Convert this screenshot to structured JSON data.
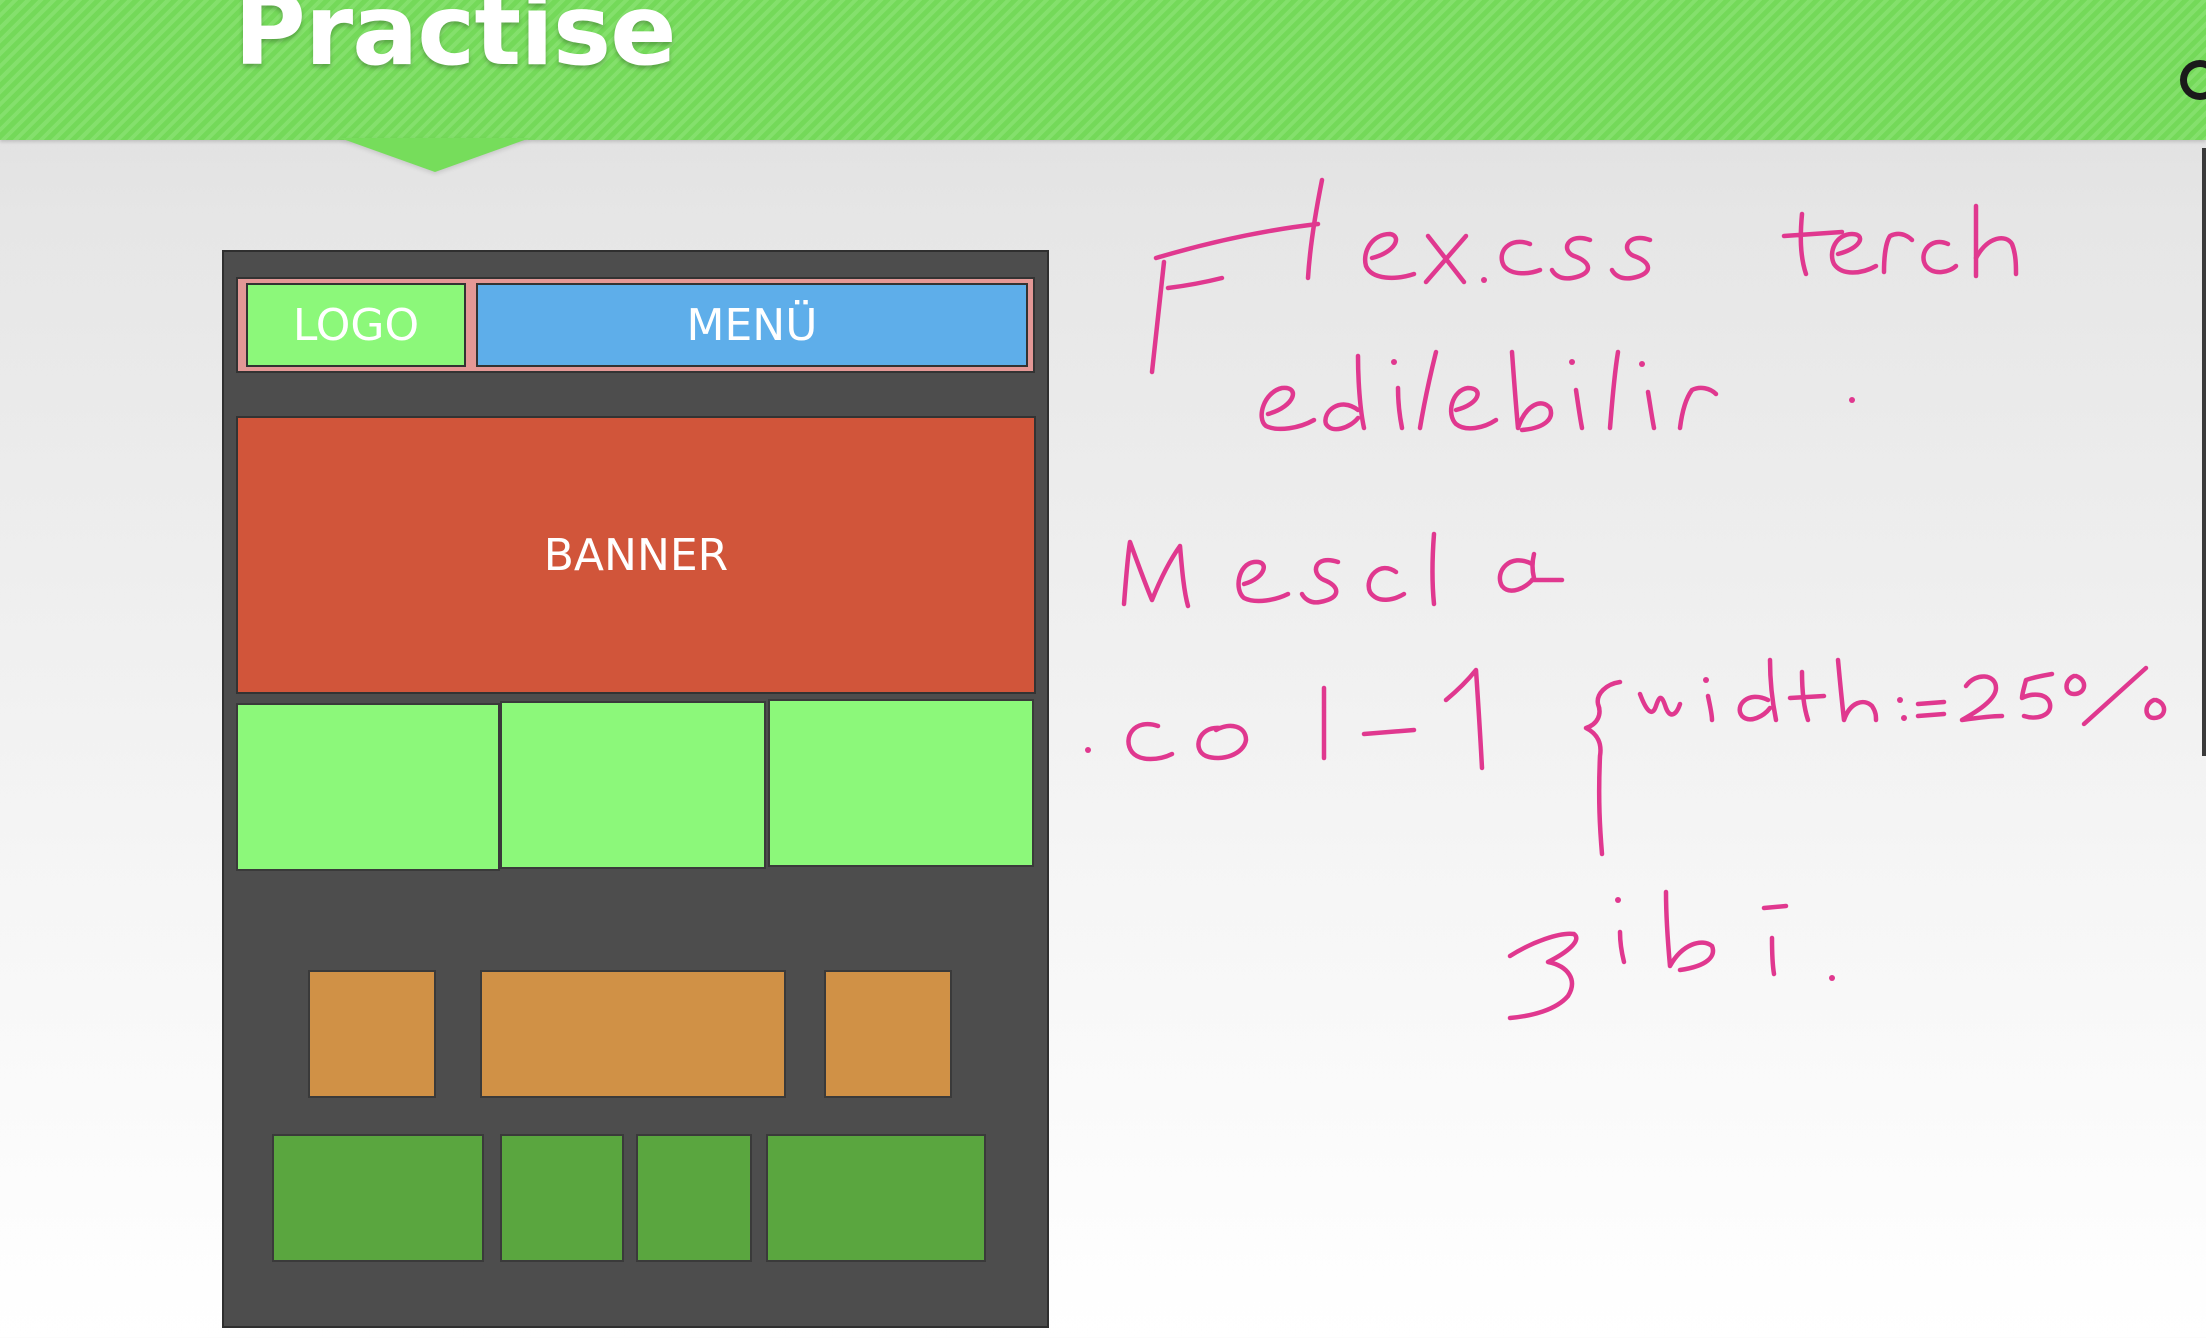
{
  "slide": {
    "title": "Practise",
    "colors": {
      "header_green": "#76dd5b",
      "ink_pink": "#e0388f",
      "mockup_bg": "#4d4d4d"
    }
  },
  "mockup": {
    "logo_label": "LOGO",
    "menu_label": "MENÜ",
    "banner_label": "BANNER",
    "colors": {
      "logo": "#8cf87a",
      "menu": "#5eaeea",
      "banner": "#d1553a",
      "light_green": "#8cf87a",
      "orange": "#d09146",
      "dark_green": "#5aa63f"
    }
  },
  "handwriting": {
    "lines": [
      "Flex.css tercih",
      "edilebilir.",
      "Mesela",
      ".col-1 {width:=25%",
      "gibi."
    ]
  }
}
